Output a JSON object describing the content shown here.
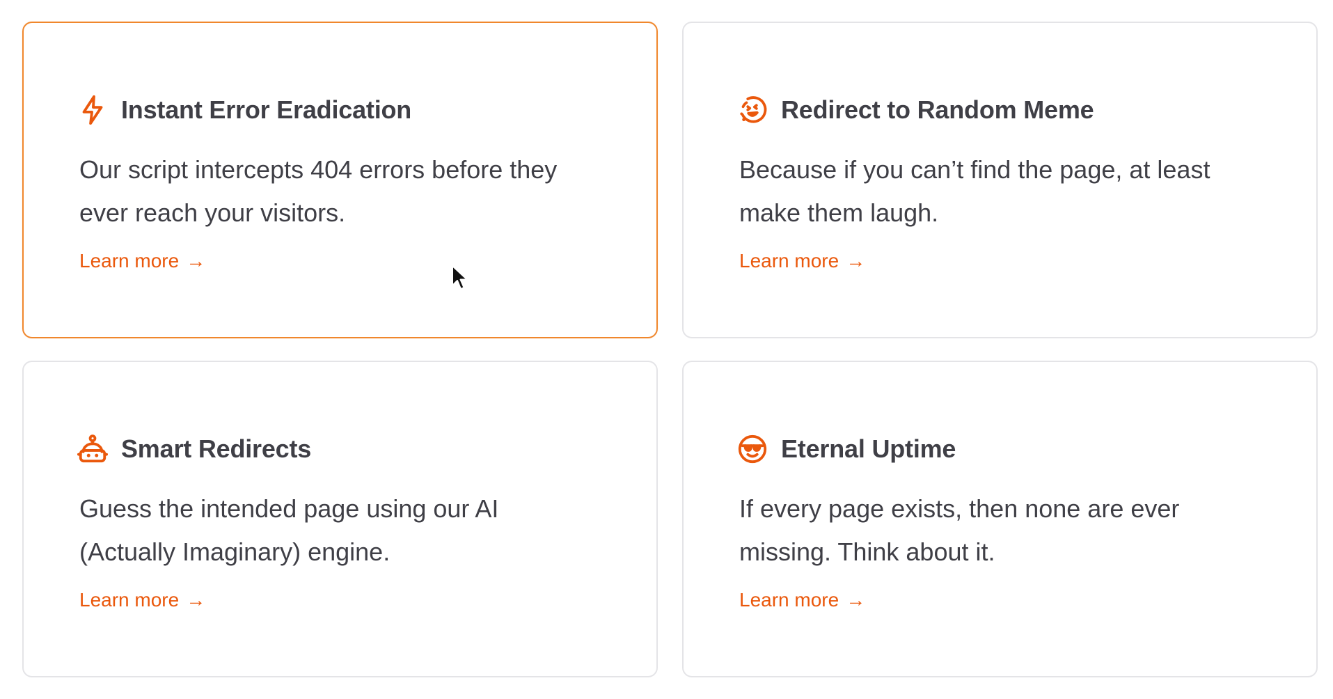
{
  "accent_color": "#ea580c",
  "active_border_color": "#f0872c",
  "cards": [
    {
      "icon": "lightning-bolt-icon",
      "title": "Instant Error Eradication",
      "description": "Our script intercepts 404 errors before they ever reach your visitors.",
      "link_label": "Learn more",
      "link_arrow": "→",
      "active": true
    },
    {
      "icon": "laughing-face-icon",
      "title": "Redirect to Random Meme",
      "description": "Because if you can’t find the page, at least make them laugh.",
      "link_label": "Learn more",
      "link_arrow": "→",
      "active": false
    },
    {
      "icon": "robot-icon",
      "title": "Smart Redirects",
      "description": "Guess the intended page using our AI (Actually Imaginary) engine.",
      "link_label": "Learn more",
      "link_arrow": "→",
      "active": false
    },
    {
      "icon": "sunglasses-face-icon",
      "title": "Eternal Uptime",
      "description": "If every page exists, then none are ever missing. Think about it.",
      "link_label": "Learn more",
      "link_arrow": "→",
      "active": false
    }
  ]
}
